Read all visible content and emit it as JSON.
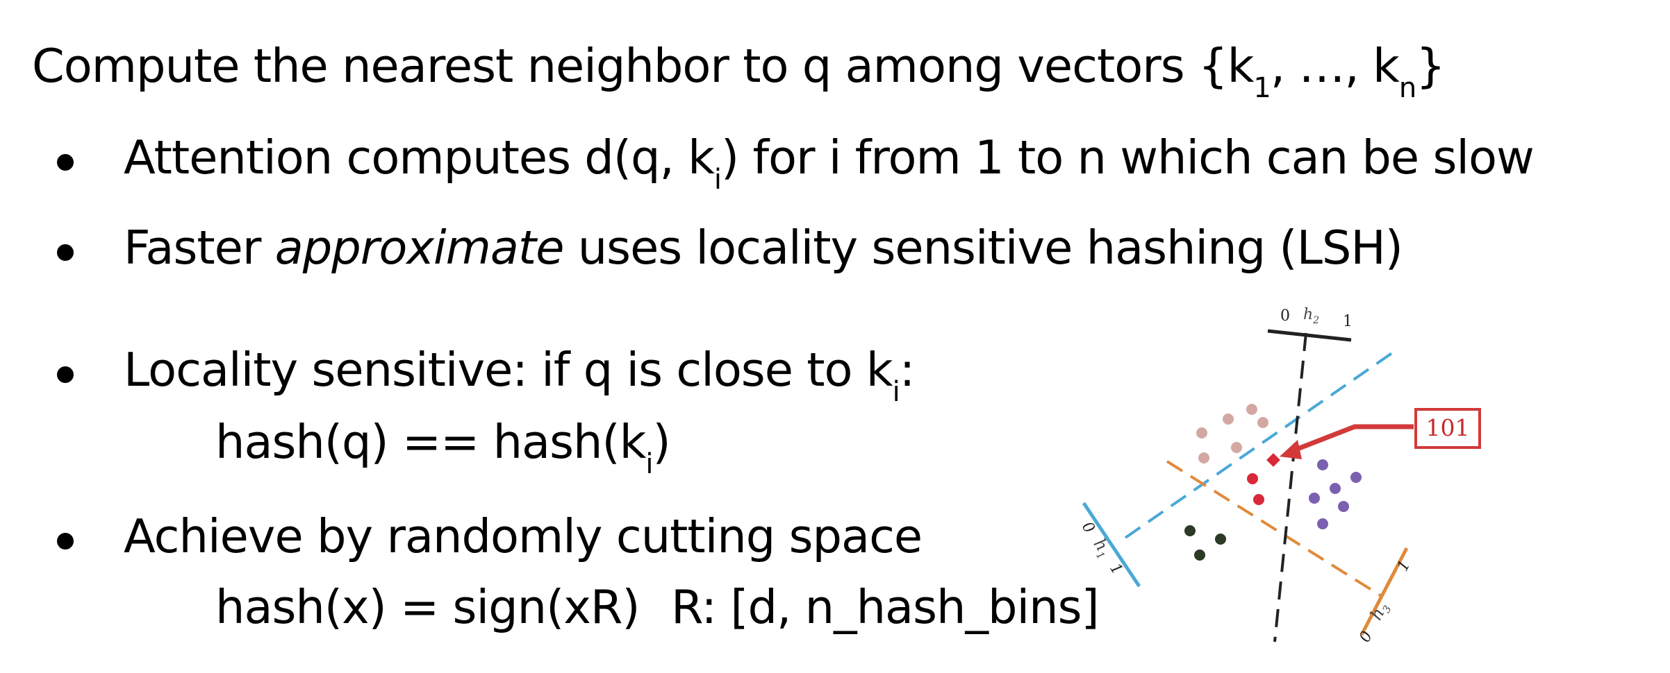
{
  "slide": {
    "heading": {
      "before": "Compute the nearest neighbor to q among vectors {k",
      "sub1": "1",
      "middle": ", …, k",
      "sub2": "n",
      "after": "}"
    },
    "bullets": [
      {
        "before": "Attention computes d(q, k",
        "sub": "i",
        "after": ") for i from 1 to n which can be slow"
      },
      {
        "plain": "Faster ",
        "emphasis": "approximate",
        "after": " uses locality sensitive hashing (LSH)"
      },
      {
        "before": "Locality sensitive: if q is close to k",
        "sub": "i",
        "after": ":",
        "detail": {
          "before": "hash(q) == hash(k",
          "sub": "i",
          "after": ")"
        }
      },
      {
        "text": "Achieve by randomly cutting space",
        "detail": {
          "formula": "hash(x) = sign(xR)",
          "shape": "R: [d, n_hash_bins]"
        }
      }
    ]
  },
  "diagram": {
    "hash_code": "101",
    "hyperplanes": [
      {
        "name": "h",
        "index": "1",
        "zero": "0",
        "one": "1",
        "color": "#4aa8d6"
      },
      {
        "name": "h",
        "index": "2",
        "zero": "0",
        "one": "1",
        "color": "#222222"
      },
      {
        "name": "h",
        "index": "3",
        "zero": "0",
        "one": "1",
        "color": "#e08a3a"
      }
    ],
    "colors": {
      "accent_red": "#d23a3a",
      "pink_dots": "#d4a8a2",
      "red_dots": "#d8283a",
      "purple_dots": "#7b5fb0",
      "dark_dots": "#2a3a24"
    }
  }
}
